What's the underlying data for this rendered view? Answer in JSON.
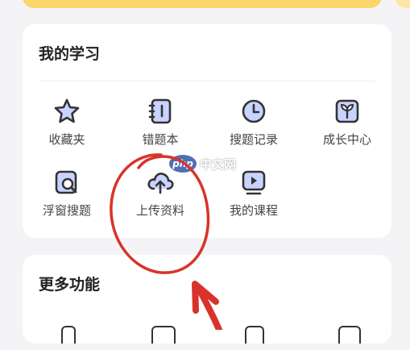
{
  "my_study": {
    "title": "我的学习",
    "items": [
      {
        "label": "收藏夹",
        "icon": "star-icon"
      },
      {
        "label": "错题本",
        "icon": "notebook-icon"
      },
      {
        "label": "搜题记录",
        "icon": "clock-icon"
      },
      {
        "label": "成长中心",
        "icon": "sprout-icon"
      },
      {
        "label": "浮窗搜题",
        "icon": "magnifier-window-icon"
      },
      {
        "label": "上传资料",
        "icon": "cloud-upload-icon"
      },
      {
        "label": "我的课程",
        "icon": "video-play-icon"
      }
    ]
  },
  "more_features": {
    "title": "更多功能"
  },
  "watermark": {
    "badge": "php",
    "text": "中文网"
  },
  "colors": {
    "accent": "#fbd66a",
    "icon_fill": "#c9d3ff",
    "annotation": "#d8332b"
  }
}
